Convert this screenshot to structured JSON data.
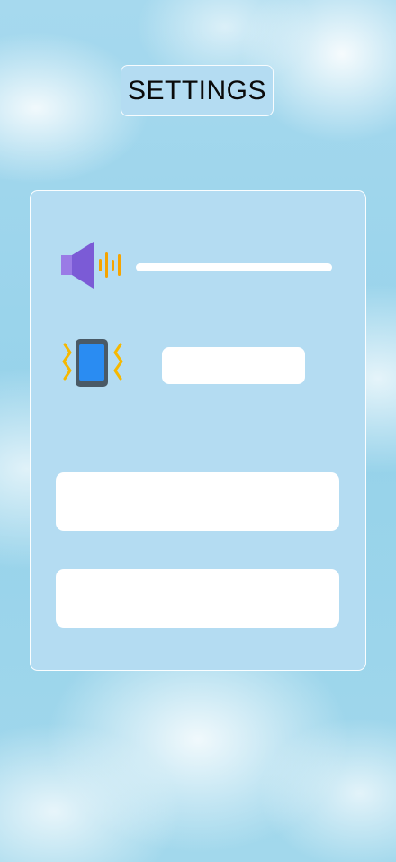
{
  "header": {
    "title": "SETTINGS"
  },
  "settings_panel": {
    "volume": {
      "icon": "speaker-icon",
      "level": 1.0
    },
    "vibration": {
      "icon": "vibrating-phone-icon",
      "value": ""
    },
    "fields": [
      {
        "value": ""
      },
      {
        "value": ""
      }
    ]
  },
  "colors": {
    "panel_background": "#b4dcf2",
    "panel_border": "#ffffff",
    "control_fill": "#ffffff",
    "speaker_purple": "#7b5bd6",
    "sound_wave_orange": "#f6a400",
    "phone_body": "#4a5a66",
    "phone_screen": "#2a8cf2"
  }
}
